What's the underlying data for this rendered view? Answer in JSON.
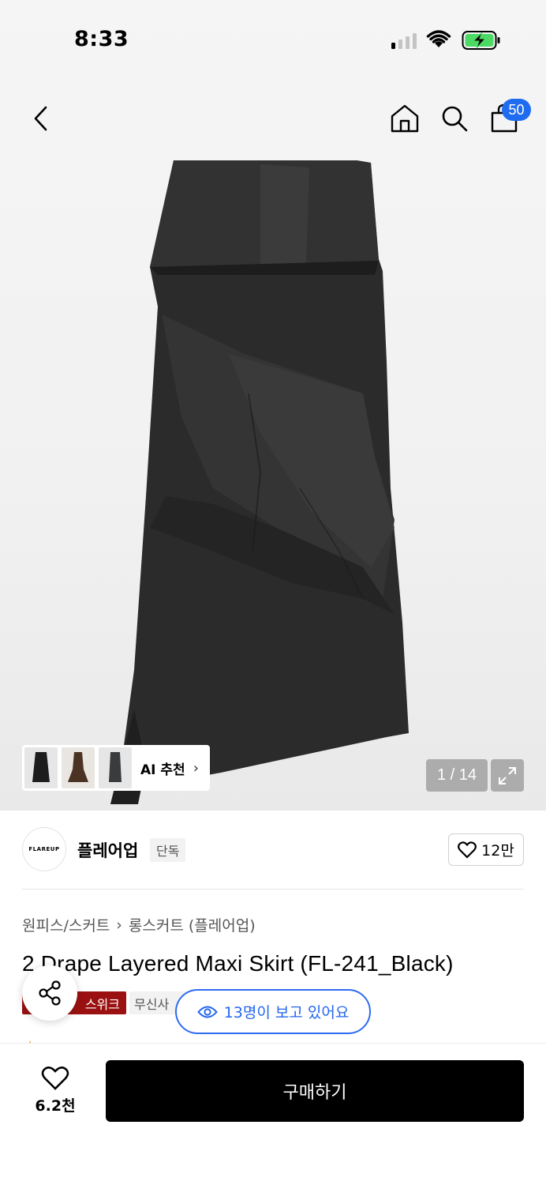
{
  "status_bar": {
    "time": "8:33"
  },
  "header": {
    "cart_count": "50"
  },
  "gallery": {
    "ai_label": "AI 추천",
    "counter": "1 / 14"
  },
  "brand": {
    "logo_text": "FLAREUP",
    "name": "플레어업",
    "badge": "단독",
    "like_count": "12만"
  },
  "product": {
    "breadcrumb": [
      "원피스/스커트",
      "롱스커트 (플레어업)"
    ],
    "title": "2 Drape Layered Maxi Skirt (FL-241_Black)",
    "tag_primary": "스위크",
    "tag_secondary": "무신사",
    "viewers": "13명이 보고 있어요"
  },
  "bottom_bar": {
    "wish_count": "6.2천",
    "buy_label": "구매하기"
  },
  "colors": {
    "accent": "#1f6cf0",
    "tag_red": "#9b1111",
    "buy_button": "#000000"
  }
}
